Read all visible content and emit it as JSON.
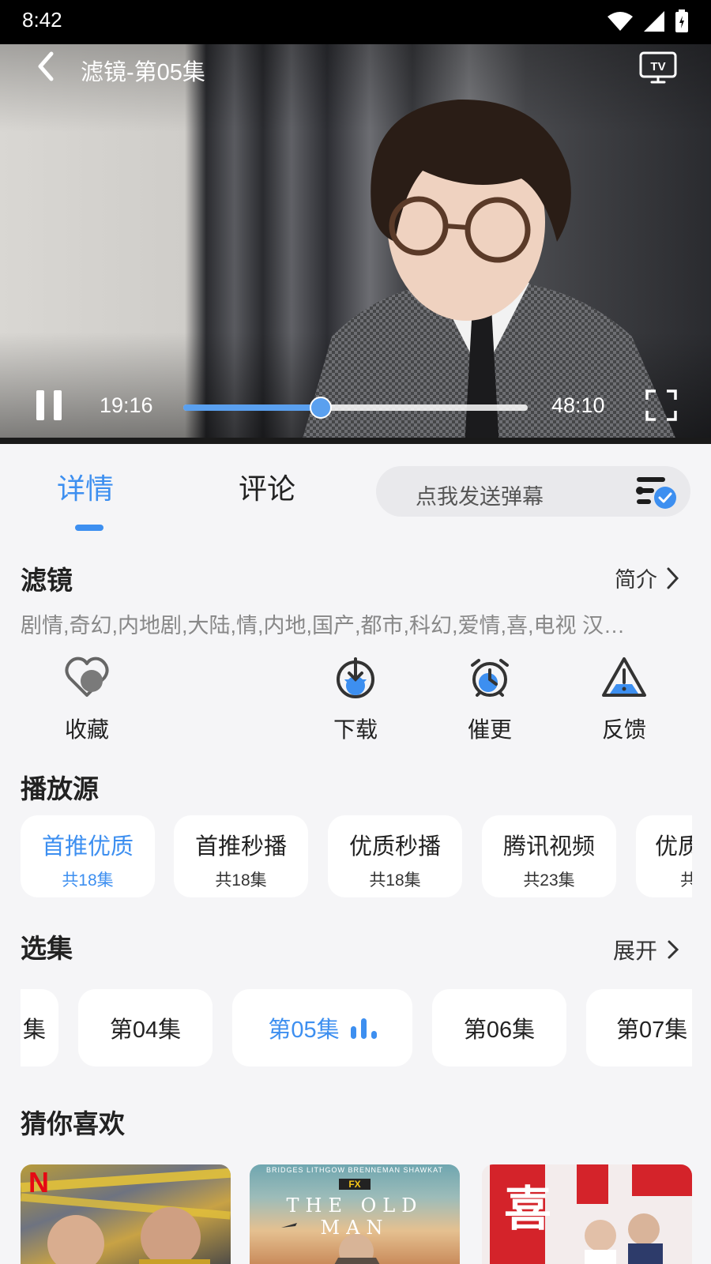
{
  "status_bar": {
    "time": "8:42",
    "icons": [
      "wifi-icon",
      "signal-icon",
      "battery-icon"
    ]
  },
  "player": {
    "title": "滤镜-第05集",
    "current_time": "19:16",
    "total_time": "48:10",
    "progress_fraction": 0.4,
    "state": "playing",
    "icons": [
      "back-icon",
      "tv-cast-icon",
      "pause-icon",
      "fullscreen-icon"
    ]
  },
  "tabs": [
    {
      "label": "详情",
      "active": true
    },
    {
      "label": "评论",
      "active": false
    }
  ],
  "danmaku": {
    "placeholder": "点我发送弹幕"
  },
  "show": {
    "title": "滤镜",
    "intro_label": "简介",
    "tags": "剧情,奇幻,内地剧,大陆,情,内地,国产,都市,科幻,爱情,喜,电视 汉…"
  },
  "actions": [
    {
      "label": "收藏",
      "icon": "heart-icon"
    },
    {
      "label": "下载",
      "icon": "download-icon"
    },
    {
      "label": "催更",
      "icon": "alarm-icon"
    },
    {
      "label": "反馈",
      "icon": "warning-icon"
    }
  ],
  "sources": {
    "heading": "播放源",
    "items": [
      {
        "name": "首推优质",
        "count": "共18集",
        "active": true
      },
      {
        "name": "首推秒播",
        "count": "共18集",
        "active": false
      },
      {
        "name": "优质秒播",
        "count": "共18集",
        "active": false
      },
      {
        "name": "腾讯视频",
        "count": "共23集",
        "active": false
      },
      {
        "name": "优质",
        "count": "共",
        "active": false
      }
    ]
  },
  "episodes": {
    "heading": "选集",
    "expand_label": "展开",
    "items": [
      {
        "label": "集",
        "active": false
      },
      {
        "label": "第04集",
        "active": false
      },
      {
        "label": "第05集",
        "active": true
      },
      {
        "label": "第06集",
        "active": false
      },
      {
        "label": "第07集",
        "active": false
      }
    ]
  },
  "recommendations": {
    "heading": "猜你喜欢",
    "items": [
      {
        "poster_text": "N"
      },
      {
        "poster_text": "THE OLD MAN",
        "top_text": "BRIDGES   LITHGOW   BRENNEMAN   SHAWKAT",
        "badge": "FX"
      },
      {
        "poster_text": "喜"
      }
    ]
  },
  "colors": {
    "accent": "#3d8ff0",
    "background": "#f5f5f7"
  }
}
